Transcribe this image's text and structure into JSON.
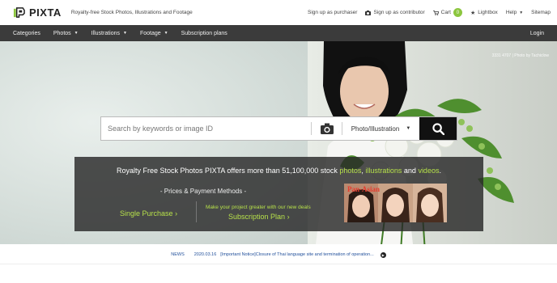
{
  "header": {
    "logo_text": "PIXTA",
    "tagline": "Royalty-free Stock Photos, Illustrations and Footage",
    "links": {
      "signup_purchaser": "Sign up as purchaser",
      "signup_contributor": "Sign up as contributor",
      "cart": "Cart",
      "cart_count": "0",
      "lightbox": "Lightbox",
      "help": "Help",
      "sitemap": "Sitemap"
    }
  },
  "nav": {
    "categories": "Categories",
    "photos": "Photos",
    "illustrations": "Illustrations",
    "footage": "Footage",
    "subscription": "Subscription plans",
    "login": "Login"
  },
  "hero": {
    "credit": "3331 4707 | Photo by Tachiclow"
  },
  "search": {
    "placeholder": "Search by keywords or image ID",
    "type_value": "Photo/Illustration"
  },
  "promo": {
    "head_prefix": "Royalty Free Stock Photos  PIXTA offers more than 51,100,000 stock ",
    "head_photos": "photos",
    "head_sep1": ", ",
    "head_illustrations": "illustrations",
    "head_and": " and ",
    "head_videos": "videos",
    "head_end": ".",
    "prices": "- Prices & Payment Methods -",
    "single": "Single Purchase",
    "sub_note": "Make your project greater with our new deals",
    "sub_plan": "Subscription Plan",
    "image_title": "Pan-Asian"
  },
  "news": {
    "label": "NEWS",
    "date": "2020.03.16",
    "text": "[Important Notice]Closure of Thai language site and termination of operation..."
  },
  "colors": {
    "accent_green": "#b6e04a",
    "nav_bg": "#3b3b3b",
    "link_blue": "#1f4e9a"
  }
}
